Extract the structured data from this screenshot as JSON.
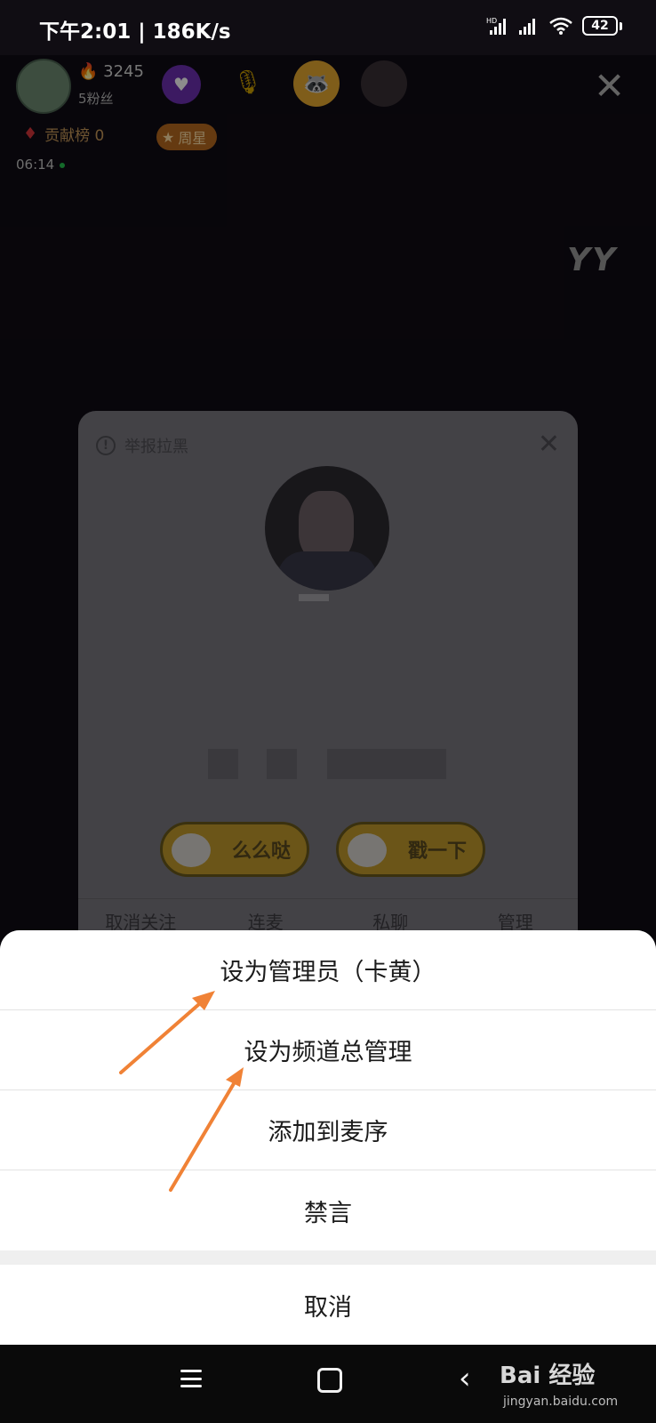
{
  "status_bar": {
    "time": "下午2:01 | 186K/s",
    "battery": "42",
    "hd": "HD"
  },
  "live_room": {
    "heat": "3245",
    "fans": "5粉丝",
    "contribution": "贡献榜 0",
    "week_star": "周星",
    "live_duration": "06:14",
    "logo": "YY"
  },
  "user_card": {
    "report_label": "举报拉黑",
    "gift_buttons": [
      "么么哒",
      "戳一下"
    ],
    "tabs": [
      "取消关注",
      "连麦",
      "私聊",
      "管理"
    ]
  },
  "action_sheet": {
    "items": [
      "设为管理员（卡黄）",
      "设为频道总管理",
      "添加到麦序",
      "禁言"
    ],
    "cancel": "取消"
  },
  "watermark": {
    "brand": "Bai 经验",
    "url": "jingyan.baidu.com"
  },
  "colors": {
    "arrow": "#f08236",
    "sheet_bg": "#ffffff",
    "room_bg": "#100b14"
  }
}
